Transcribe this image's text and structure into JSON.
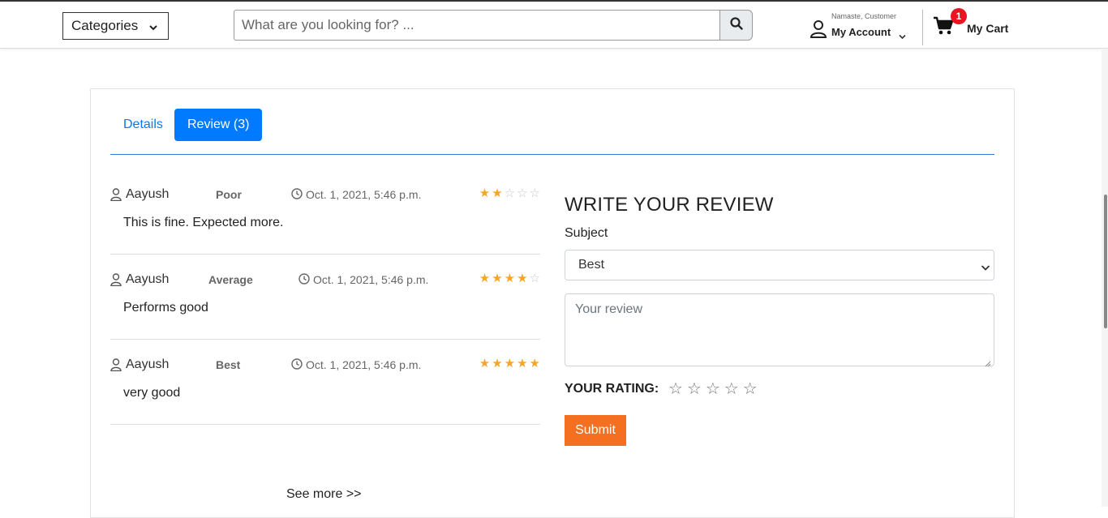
{
  "header": {
    "categories_label": "Categories",
    "search_placeholder": "What are you looking for? ...",
    "greeting": "Namaste, Customer",
    "account_label": "My Account",
    "cart_count": "1",
    "cart_label": "My Cart"
  },
  "tabs": {
    "details": "Details",
    "review": "Review (3)"
  },
  "reviews": [
    {
      "user": "Aayush",
      "subject": "Poor",
      "date": "Oct. 1, 2021, 5:46 p.m.",
      "rating": 2,
      "body": "This is fine. Expected more."
    },
    {
      "user": "Aayush",
      "subject": "Average",
      "date": "Oct. 1, 2021, 5:46 p.m.",
      "rating": 4,
      "body": "Performs good"
    },
    {
      "user": "Aayush",
      "subject": "Best",
      "date": "Oct. 1, 2021, 5:46 p.m.",
      "rating": 5,
      "body": "very good"
    }
  ],
  "see_more": "See more >>",
  "write_review": {
    "title": "WRITE YOUR REVIEW",
    "subject_label": "Subject",
    "subject_value": "Best",
    "review_placeholder": "Your review",
    "rating_label": "YOUR RATING:",
    "submit_label": "Submit"
  },
  "colors": {
    "accent": "#007bff",
    "star": "#f6a623",
    "submit": "#f46f1f",
    "badge": "#e8141f"
  }
}
